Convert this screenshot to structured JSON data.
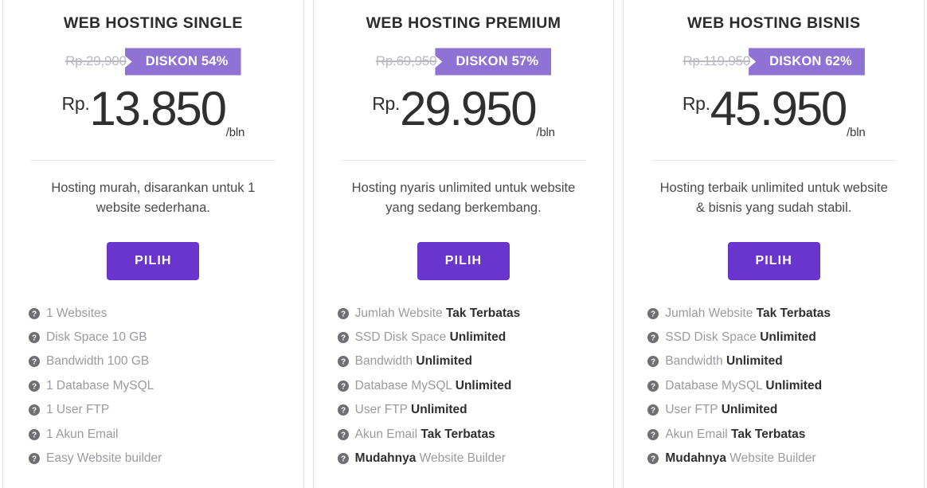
{
  "plans": [
    {
      "title": "WEB HOSTING SINGLE",
      "old_price": "Rp.29,900",
      "discount_badge": "DISKON 54%",
      "currency": "Rp.",
      "price": "13.850",
      "period": "/bln",
      "description": "Hosting murah, disarankan untuk 1 website sederhana.",
      "button_label": "PILIH",
      "features": [
        {
          "text": "1 Websites",
          "strong": "",
          "strong_first": false
        },
        {
          "text": "Disk Space 10 GB",
          "strong": "",
          "strong_first": false
        },
        {
          "text": "Bandwidth 100 GB",
          "strong": "",
          "strong_first": false
        },
        {
          "text": "1 Database MySQL",
          "strong": "",
          "strong_first": false
        },
        {
          "text": "1 User FTP",
          "strong": "",
          "strong_first": false
        },
        {
          "text": "1 Akun Email",
          "strong": "",
          "strong_first": false
        },
        {
          "text": "Easy Website builder",
          "strong": "",
          "strong_first": false
        }
      ]
    },
    {
      "title": "WEB HOSTING PREMIUM",
      "old_price": "Rp.69,950",
      "discount_badge": "DISKON 57%",
      "currency": "Rp.",
      "price": "29.950",
      "period": "/bln",
      "description": "Hosting nyaris unlimited untuk website yang sedang berkembang.",
      "button_label": "PILIH",
      "features": [
        {
          "text": "Jumlah Website ",
          "strong": "Tak Terbatas",
          "strong_first": false
        },
        {
          "text": "SSD Disk Space ",
          "strong": "Unlimited",
          "strong_first": false
        },
        {
          "text": "Bandwidth ",
          "strong": "Unlimited",
          "strong_first": false
        },
        {
          "text": "Database MySQL ",
          "strong": "Unlimited",
          "strong_first": false
        },
        {
          "text": "User FTP ",
          "strong": "Unlimited",
          "strong_first": false
        },
        {
          "text": "Akun Email ",
          "strong": "Tak Terbatas",
          "strong_first": false
        },
        {
          "text": " Website Builder",
          "strong": "Mudahnya",
          "strong_first": true
        }
      ]
    },
    {
      "title": "WEB HOSTING BISNIS",
      "old_price": "Rp.119,950",
      "discount_badge": "DISKON 62%",
      "currency": "Rp.",
      "price": "45.950",
      "period": "/bln",
      "description": "Hosting terbaik unlimited untuk website & bisnis yang sudah stabil.",
      "button_label": "PILIH",
      "features": [
        {
          "text": "Jumlah Website ",
          "strong": "Tak Terbatas",
          "strong_first": false
        },
        {
          "text": "SSD Disk Space ",
          "strong": "Unlimited",
          "strong_first": false
        },
        {
          "text": "Bandwidth ",
          "strong": "Unlimited",
          "strong_first": false
        },
        {
          "text": "Database MySQL ",
          "strong": "Unlimited",
          "strong_first": false
        },
        {
          "text": "User FTP ",
          "strong": "Unlimited",
          "strong_first": false
        },
        {
          "text": "Akun Email ",
          "strong": "Tak Terbatas",
          "strong_first": false
        },
        {
          "text": " Website Builder",
          "strong": "Mudahnya",
          "strong_first": true
        }
      ]
    }
  ],
  "icons": {
    "feature_help": "help-circle-icon"
  },
  "colors": {
    "badge_purple": "#8f73d4",
    "button_purple": "#6a35cc",
    "price_dark": "#2f2f2f",
    "muted_gray": "#9a9aa0",
    "old_price_gray": "#b9b9c2",
    "border_gray": "#e2e2e4"
  }
}
